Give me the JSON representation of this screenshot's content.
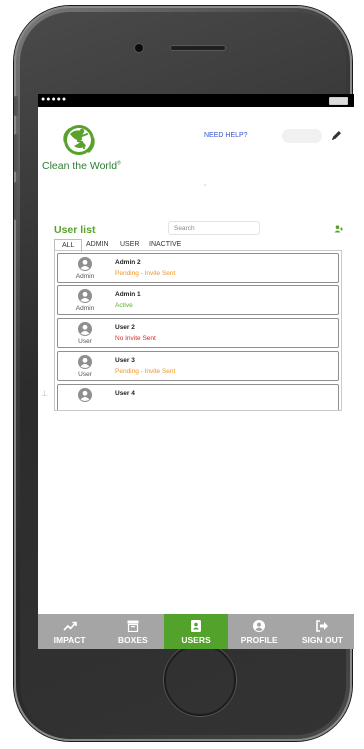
{
  "header": {
    "logo_text": "Clean the World",
    "logo_mark": "®",
    "help_link": "NEED HELP?"
  },
  "userlist": {
    "title": "User list",
    "search_placeholder": "Search",
    "tabs": [
      {
        "label": "ALL",
        "active": true
      },
      {
        "label": "ADMIN",
        "active": false
      },
      {
        "label": "USER",
        "active": false
      },
      {
        "label": "INACTIVE",
        "active": false
      }
    ],
    "rows": [
      {
        "role": "Admin",
        "name": "Admin 2",
        "status": "Pending - Invite Sent",
        "status_color": "#f0941d"
      },
      {
        "role": "Admin",
        "name": "Admin 1",
        "status": "Active",
        "status_color": "#5fae2d"
      },
      {
        "role": "User",
        "name": "User 2",
        "status": "No Invite Sent",
        "status_color": "#d32f2f"
      },
      {
        "role": "User",
        "name": "User 3",
        "status": "Pending - Invite Sent",
        "status_color": "#f0941d"
      },
      {
        "role": "",
        "name": "User 4",
        "status": "",
        "status_color": "#555555"
      }
    ]
  },
  "tabbar": {
    "items": [
      {
        "label": "IMPACT",
        "icon": "trending-up-icon",
        "active": false
      },
      {
        "label": "BOXES",
        "icon": "archive-box-icon",
        "active": false
      },
      {
        "label": "USERS",
        "icon": "contact-book-icon",
        "active": true
      },
      {
        "label": "PROFILE",
        "icon": "user-circle-icon",
        "active": false
      },
      {
        "label": "SIGN OUT",
        "icon": "sign-out-icon",
        "active": false
      }
    ]
  },
  "colors": {
    "brand_green": "#58a12b",
    "active_tab": "#53a22b",
    "tabbar_bg": "#a5a5a5",
    "link_blue": "#3a53c9"
  }
}
